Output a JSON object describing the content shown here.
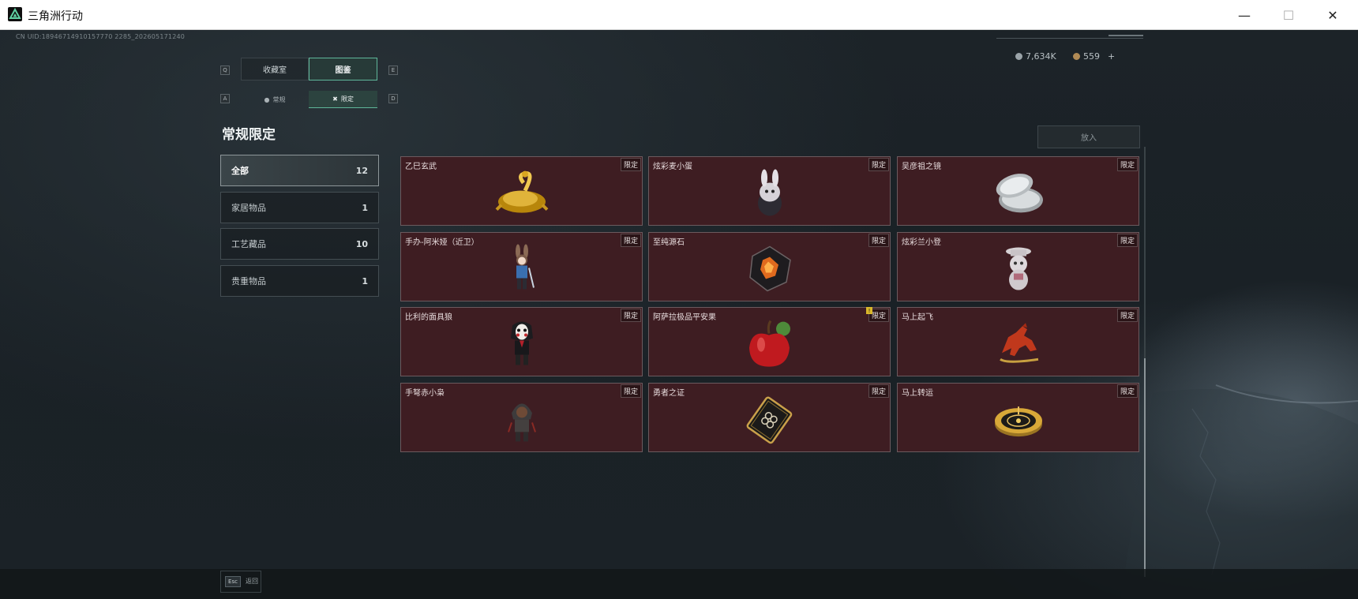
{
  "window": {
    "title": "三角洲行动",
    "minimize_glyph": "—",
    "maximize_glyph": "☐",
    "close_glyph": "✕"
  },
  "hud": {
    "uid": "CN UID:18946714910157770 2285_202605171240",
    "currency_a": {
      "value": "7,634K",
      "color": "#9aa3a8"
    },
    "currency_b": {
      "value": "559",
      "plus": "+",
      "color": "#b08a55"
    }
  },
  "tabs": {
    "prev_key": "Q",
    "next_key": "E",
    "items": [
      {
        "label": "收藏室"
      },
      {
        "label": "图鉴",
        "active": true
      }
    ]
  },
  "subtabs": {
    "prev_key": "A",
    "next_key": "D",
    "items": [
      {
        "label": "常规",
        "icon": "flame-icon"
      },
      {
        "label": "限定",
        "icon": "crossed-icon",
        "active": true
      }
    ]
  },
  "section_title": "常规限定",
  "import_button": "放入",
  "categories": [
    {
      "label": "全部",
      "count": "12",
      "active": true
    },
    {
      "label": "家居物品",
      "count": "1"
    },
    {
      "label": "工艺藏品",
      "count": "10"
    },
    {
      "label": "贵重物品",
      "count": "1"
    }
  ],
  "items": [
    {
      "name": "乙巳玄武",
      "badge": "限定",
      "icon": "gold-serpent-turtle-icon"
    },
    {
      "name": "炫彩麦小蛋",
      "badge": "限定",
      "icon": "rabbit-egg-figure-icon"
    },
    {
      "name": "吴彦祖之镜",
      "badge": "限定",
      "icon": "silver-compact-mirror-icon"
    },
    {
      "name": "手办-阿米娅（近卫）",
      "badge": "限定",
      "icon": "amiya-figure-icon"
    },
    {
      "name": "至纯源石",
      "badge": "限定",
      "icon": "originium-crystal-icon"
    },
    {
      "name": "炫彩兰小登",
      "badge": "限定",
      "icon": "bear-figure-icon"
    },
    {
      "name": "比利的面具狼",
      "badge": "限定",
      "icon": "billy-puppet-figure-icon"
    },
    {
      "name": "阿萨拉极品平安果",
      "badge": "限定",
      "icon": "red-apple-icon",
      "alert": "!"
    },
    {
      "name": "马上起飞",
      "badge": "限定",
      "icon": "red-horse-icon"
    },
    {
      "name": "手弩赤小枭",
      "badge": "限定",
      "icon": "hooded-figure-icon"
    },
    {
      "name": "勇者之证",
      "badge": "限定",
      "icon": "gold-card-icon"
    },
    {
      "name": "马上转运",
      "badge": "限定",
      "icon": "gold-compass-icon"
    }
  ],
  "footer": {
    "esc_key": "Esc",
    "esc_label": "返回"
  }
}
